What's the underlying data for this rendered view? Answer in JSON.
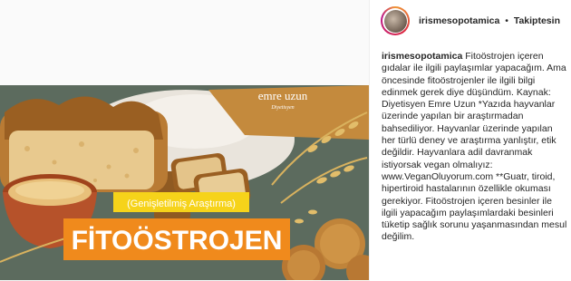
{
  "post": {
    "image": {
      "logo_text": "emre uzun",
      "logo_subtext": "Diyetisyen",
      "subtitle": "(Genişletilmiş Araştırma)",
      "title": "FİTOÖSTROJEN",
      "colors": {
        "banner_orange": "#f08a1c",
        "subtitle_yellow": "#f6d31a",
        "title_text": "#ffffff"
      }
    },
    "header": {
      "username": "irismesopotamica",
      "separator": "•",
      "follow_status": "Takiptesin",
      "avatar_icon": "profile-photo"
    },
    "caption": {
      "username": "irismesopotamica",
      "text": "Fitoöstrojen içeren gıdalar ile ilgili paylaşımlar yapacağım. Ama öncesinde fitoöstrojenler ile ilgili bilgi edinmek gerek diye düşündüm. Kaynak: Diyetisyen Emre Uzun *Yazıda hayvanlar üzerinde yapılan bir araştırmadan bahsediliyor. Hayvanlar üzerinde yapılan her türlü deney ve araştırma yanlıştır, etik değildir. Hayvanlara adil davranmak istiyorsak vegan olmalıyız: www.VeganOluyorum.com **Guatr, tiroid, hipertiroid hastalarının özellikle okuması gerekiyor. Fitoöstrojen içeren besinler ile ilgili yapacağım paylaşımlardaki besinleri tüketip sağlık sorunu yaşanmasından mesul değilim."
    }
  }
}
